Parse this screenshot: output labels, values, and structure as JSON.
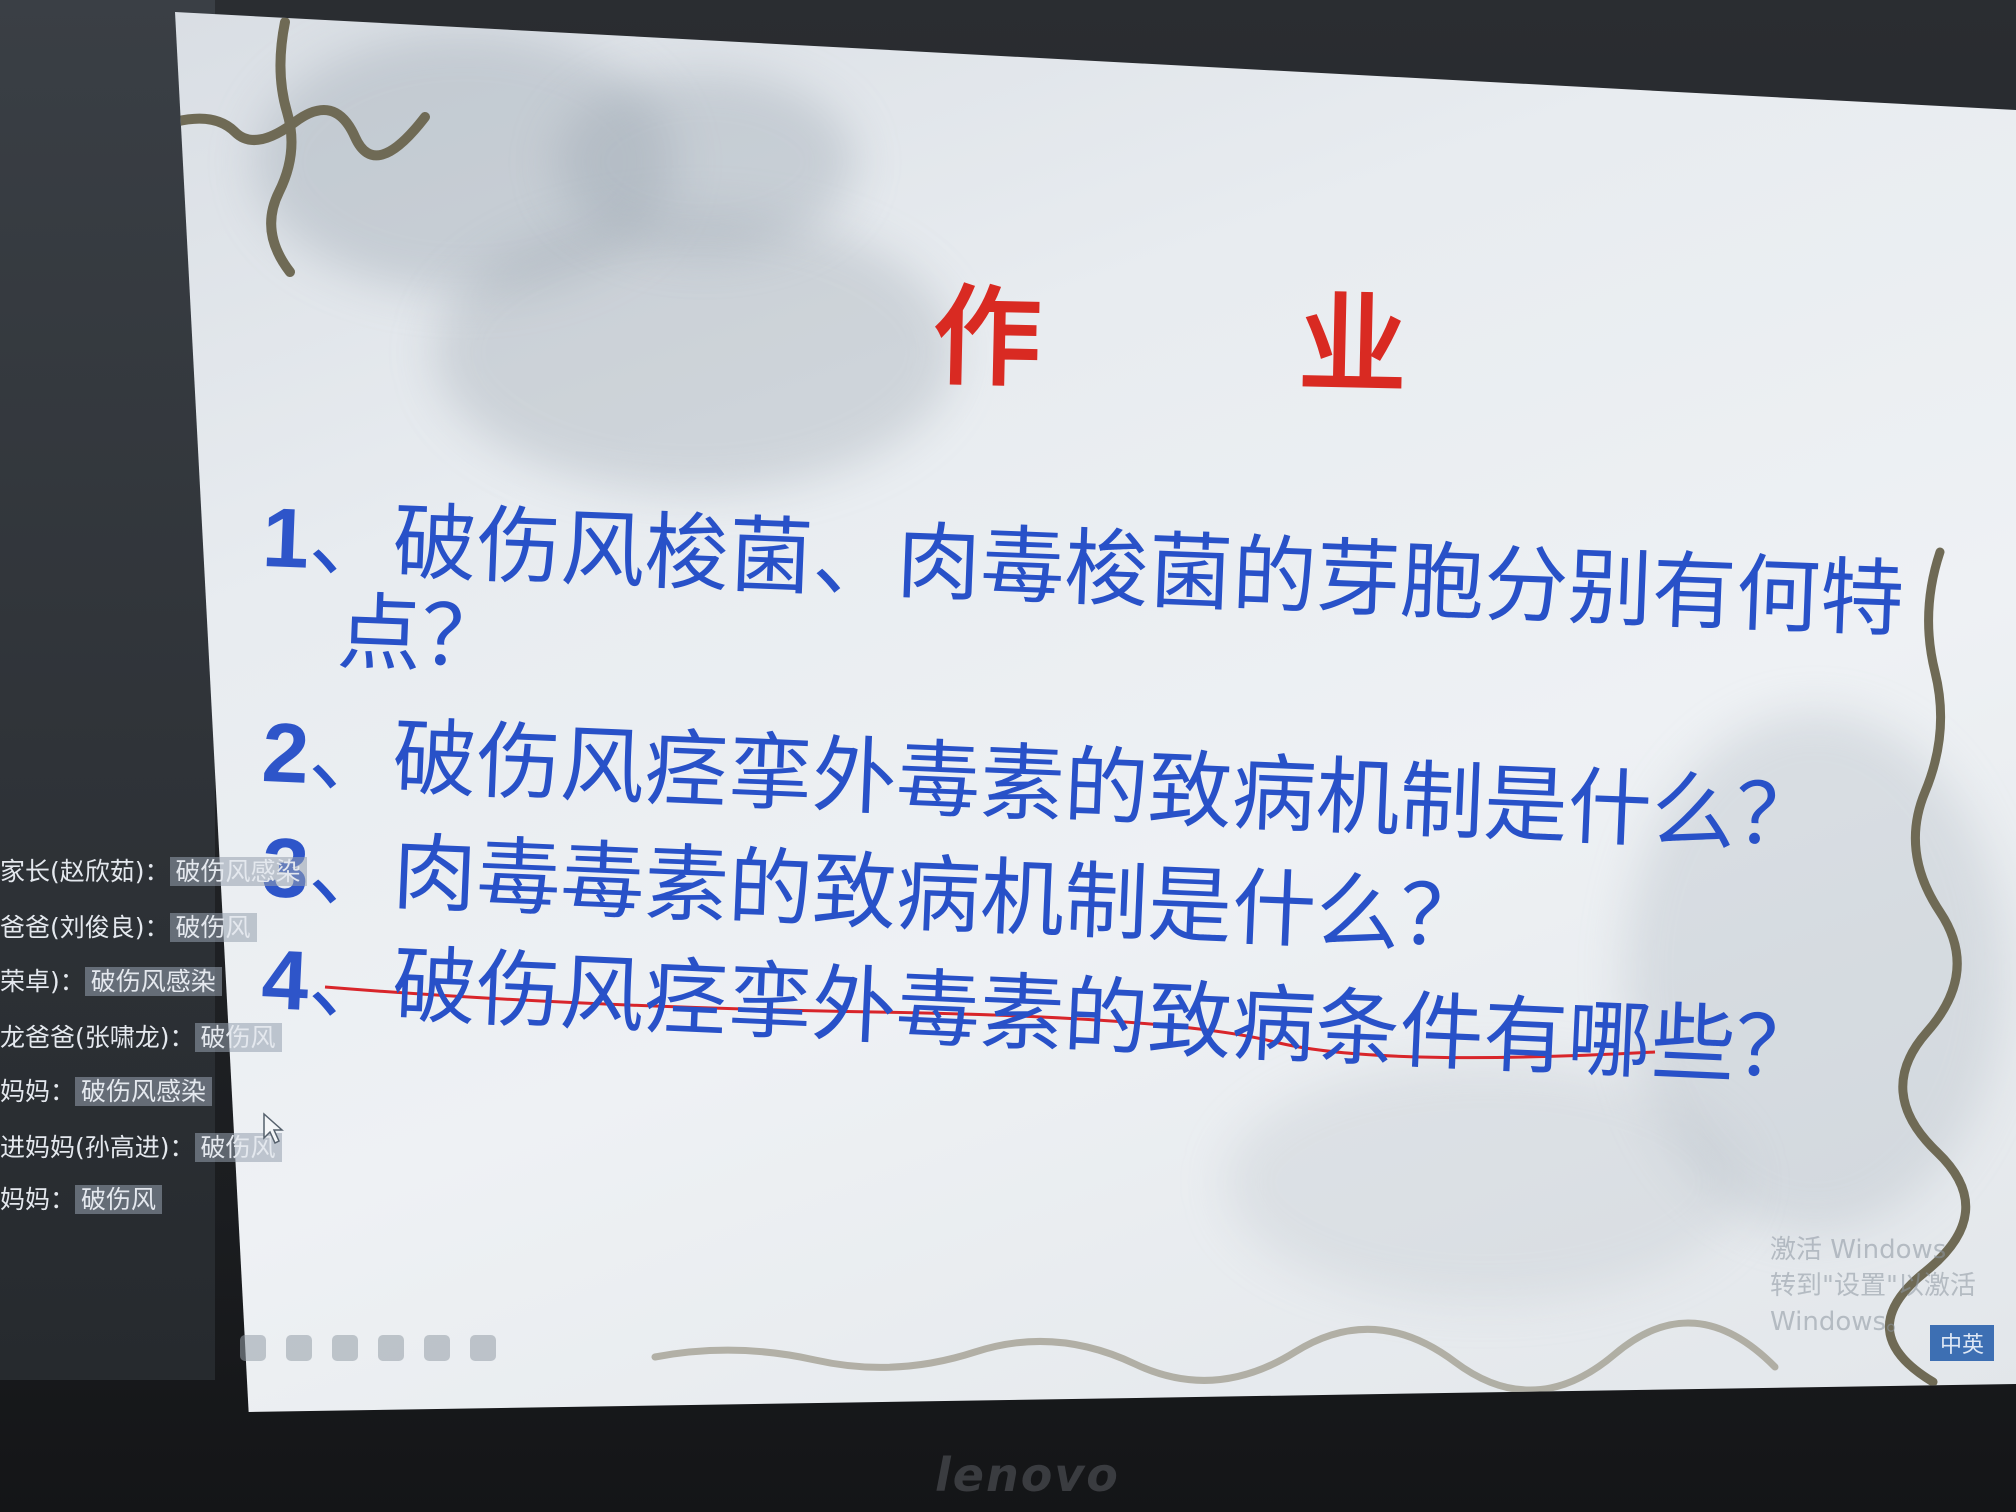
{
  "slide": {
    "title": "作 业",
    "items": [
      {
        "number": "1",
        "text": "、破伤风梭菌、肉毒梭菌的芽胞分别有何特",
        "continuation": "点？"
      },
      {
        "number": "2",
        "text": "、破伤风痉挛外毒素的致病机制是什么？"
      },
      {
        "number": "3",
        "text": "、肉毒毒素的致病机制是什么？"
      },
      {
        "number": "4",
        "text": "、破伤风痉挛外毒素的致病条件有哪些？"
      }
    ],
    "underline_color": "#d8252a",
    "title_color": "#d92a22",
    "text_color": "#2851c8"
  },
  "chat": [
    {
      "sender": "家长(赵欣茹)：",
      "message": "破伤风感染"
    },
    {
      "sender": "爸爸(刘俊良)：",
      "message": "破伤风"
    },
    {
      "sender": "荣卓)：",
      "message": "破伤风感染"
    },
    {
      "sender": "龙爸爸(张啸龙)：",
      "message": "破伤风"
    },
    {
      "sender": "妈妈：",
      "message": "破伤风感染"
    },
    {
      "sender": "进妈妈(孙高进)：",
      "message": "破伤风"
    },
    {
      "sender": "妈妈：",
      "message": "破伤风"
    }
  ],
  "toolbar": {
    "icons": [
      "pen-icon",
      "curve-icon",
      "pointer-icon",
      "eraser-icon",
      "arrow-icon",
      "settings-icon"
    ]
  },
  "watermark": {
    "line1": "激活 Windows",
    "line2": "转到\"设置\"以激活 Windows。"
  },
  "ime": {
    "label": "中英"
  },
  "brand": {
    "logo": "lenovo"
  }
}
